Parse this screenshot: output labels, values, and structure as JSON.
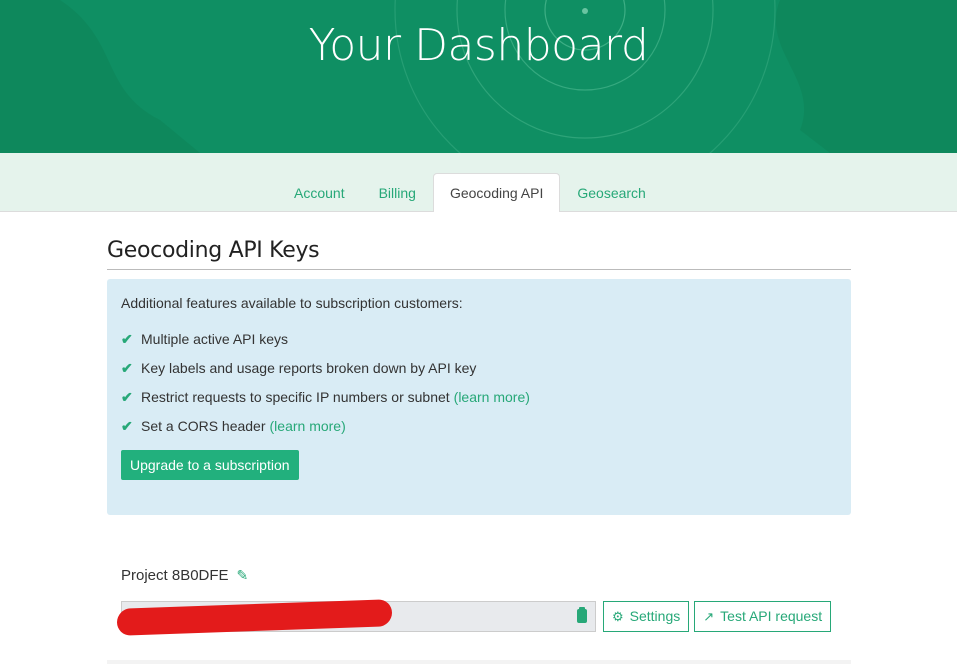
{
  "header": {
    "title": "Your Dashboard"
  },
  "tabs": [
    {
      "label": "Account",
      "active": false
    },
    {
      "label": "Billing",
      "active": false
    },
    {
      "label": "Geocoding API",
      "active": true
    },
    {
      "label": "Geosearch",
      "active": false
    }
  ],
  "main": {
    "title": "Geocoding API Keys",
    "info": {
      "intro": "Additional features available to subscription customers:",
      "features": [
        {
          "text": "Multiple active API keys",
          "link": ""
        },
        {
          "text": "Key labels and usage reports broken down by API key",
          "link": ""
        },
        {
          "text": "Restrict requests to specific IP numbers or subnet",
          "link": "(learn more)"
        },
        {
          "text": "Set a CORS header",
          "link": "(learn more)"
        }
      ],
      "upgrade_label": "Upgrade to a subscription"
    },
    "project": {
      "name": "Project 8B0DFE",
      "key_value": "",
      "settings_label": "Settings",
      "test_label": "Test API request"
    }
  },
  "icons": {
    "check": "✔",
    "pencil": "✎",
    "gear": "⚙",
    "external": "↗"
  },
  "colors": {
    "brand": "#0f8f63",
    "accent": "#27a878",
    "button": "#22b07d"
  }
}
